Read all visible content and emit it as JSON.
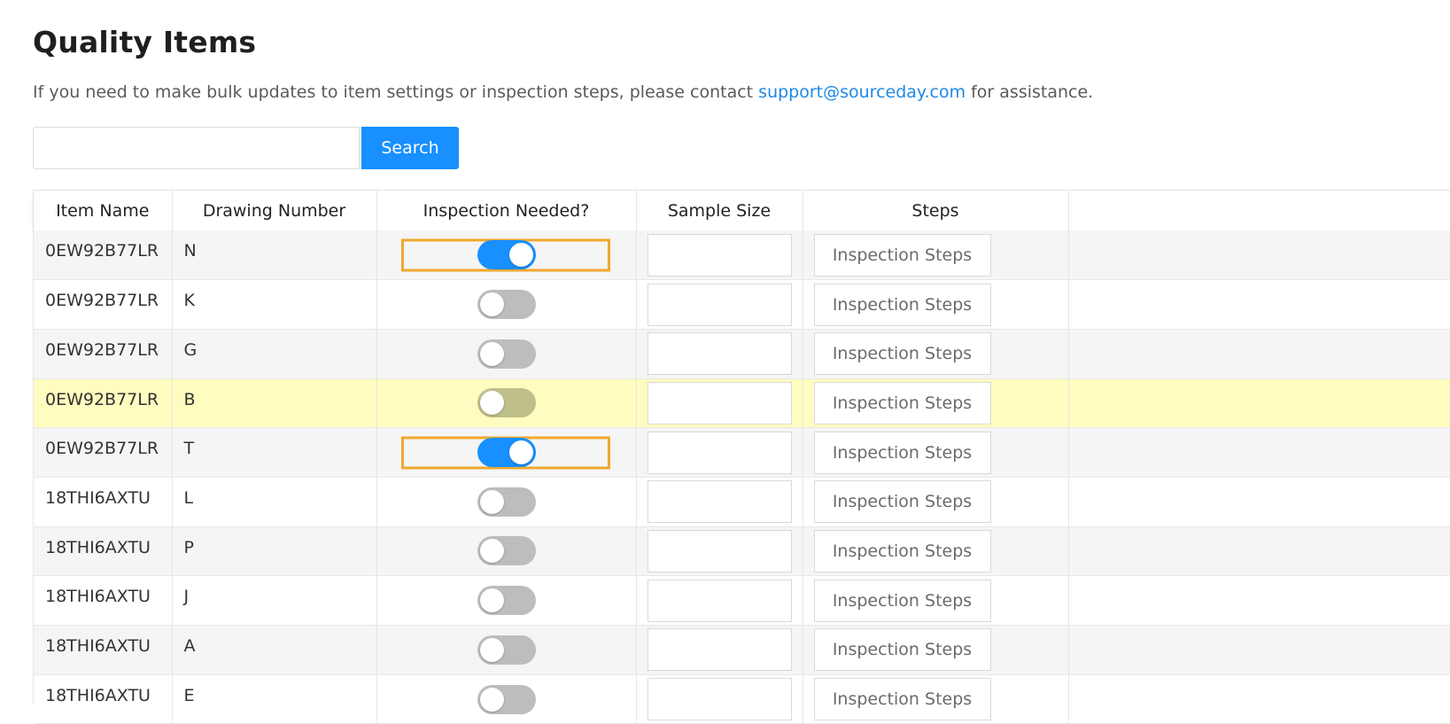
{
  "page": {
    "title": "Quality Items",
    "intro_before": "If you need to make bulk updates to item settings or inspection steps, please contact ",
    "support_email": "support@sourceday.com",
    "intro_after": " for assistance."
  },
  "search": {
    "button_label": "Search",
    "value": ""
  },
  "table": {
    "headers": {
      "item_name": "Item Name",
      "drawing_number": "Drawing Number",
      "inspection_needed": "Inspection Needed?",
      "sample_size": "Sample Size",
      "steps": "Steps"
    },
    "rows": [
      {
        "item_name": "0EW92B77LR",
        "drawing_number": "N",
        "inspection_needed": true,
        "focused": true,
        "highlighted": false,
        "sample_size": "",
        "steps_label": "Inspection Steps"
      },
      {
        "item_name": "0EW92B77LR",
        "drawing_number": "K",
        "inspection_needed": false,
        "focused": false,
        "highlighted": false,
        "sample_size": "",
        "steps_label": "Inspection Steps"
      },
      {
        "item_name": "0EW92B77LR",
        "drawing_number": "G",
        "inspection_needed": false,
        "focused": false,
        "highlighted": false,
        "sample_size": "",
        "steps_label": "Inspection Steps"
      },
      {
        "item_name": "0EW92B77LR",
        "drawing_number": "B",
        "inspection_needed": false,
        "focused": false,
        "highlighted": true,
        "sample_size": "",
        "steps_label": "Inspection Steps"
      },
      {
        "item_name": "0EW92B77LR",
        "drawing_number": "T",
        "inspection_needed": true,
        "focused": true,
        "highlighted": false,
        "sample_size": "",
        "steps_label": "Inspection Steps"
      },
      {
        "item_name": "18THI6AXTU",
        "drawing_number": "L",
        "inspection_needed": false,
        "focused": false,
        "highlighted": false,
        "sample_size": "",
        "steps_label": "Inspection Steps"
      },
      {
        "item_name": "18THI6AXTU",
        "drawing_number": "P",
        "inspection_needed": false,
        "focused": false,
        "highlighted": false,
        "sample_size": "",
        "steps_label": "Inspection Steps"
      },
      {
        "item_name": "18THI6AXTU",
        "drawing_number": "J",
        "inspection_needed": false,
        "focused": false,
        "highlighted": false,
        "sample_size": "",
        "steps_label": "Inspection Steps"
      },
      {
        "item_name": "18THI6AXTU",
        "drawing_number": "A",
        "inspection_needed": false,
        "focused": false,
        "highlighted": false,
        "sample_size": "",
        "steps_label": "Inspection Steps"
      },
      {
        "item_name": "18THI6AXTU",
        "drawing_number": "E",
        "inspection_needed": false,
        "focused": false,
        "highlighted": false,
        "sample_size": "",
        "steps_label": "Inspection Steps"
      }
    ]
  },
  "colors": {
    "primary": "#1890ff",
    "link": "#1e88e5",
    "row_highlight": "#fefcbe",
    "focus_outline": "#f0a830",
    "toggle_off": "#bdbdbd"
  }
}
